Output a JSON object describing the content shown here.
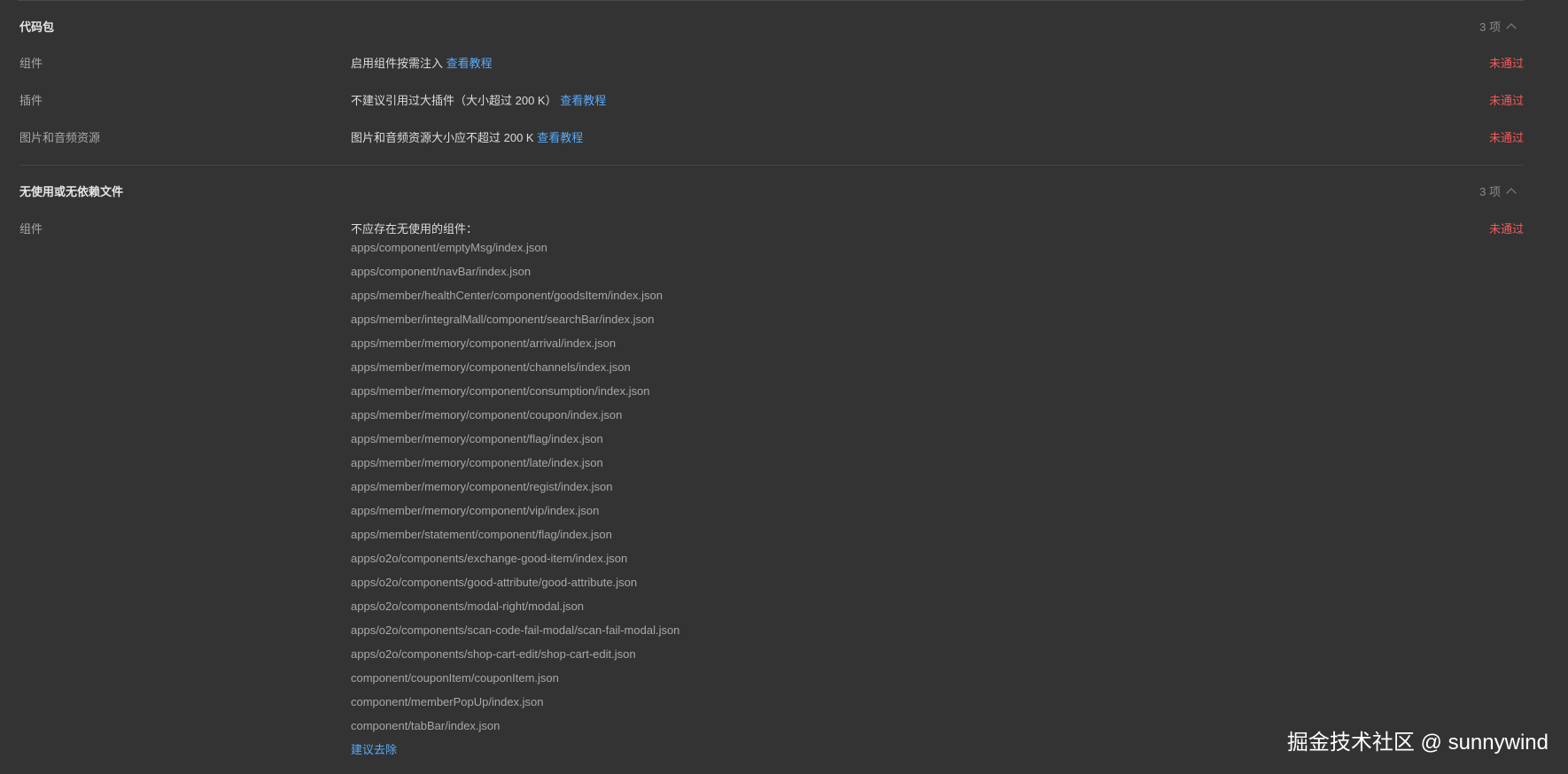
{
  "sections": [
    {
      "title": "代码包",
      "count": "3 项",
      "rows": [
        {
          "label": "组件",
          "desc": "启用组件按需注入",
          "link": "查看教程",
          "status": "未通过"
        },
        {
          "label": "插件",
          "desc": "不建议引用过大插件（大小超过 200 K）",
          "link": "查看教程",
          "status": "未通过"
        },
        {
          "label": "图片和音频资源",
          "desc": "图片和音频资源大小应不超过 200 K",
          "link": "查看教程",
          "status": "未通过"
        }
      ]
    },
    {
      "title": "无使用或无依赖文件",
      "count": "3 项",
      "rows": [
        {
          "label": "组件",
          "desc": "不应存在无使用的组件：",
          "status": "未通过"
        }
      ],
      "files": [
        "apps/component/emptyMsg/index.json",
        "apps/component/navBar/index.json",
        "apps/member/healthCenter/component/goodsItem/index.json",
        "apps/member/integralMall/component/searchBar/index.json",
        "apps/member/memory/component/arrival/index.json",
        "apps/member/memory/component/channels/index.json",
        "apps/member/memory/component/consumption/index.json",
        "apps/member/memory/component/coupon/index.json",
        "apps/member/memory/component/flag/index.json",
        "apps/member/memory/component/late/index.json",
        "apps/member/memory/component/regist/index.json",
        "apps/member/memory/component/vip/index.json",
        "apps/member/statement/component/flag/index.json",
        "apps/o2o/components/exchange-good-item/index.json",
        "apps/o2o/components/good-attribute/good-attribute.json",
        "apps/o2o/components/modal-right/modal.json",
        "apps/o2o/components/scan-code-fail-modal/scan-fail-modal.json",
        "apps/o2o/components/shop-cart-edit/shop-cart-edit.json",
        "component/couponItem/couponItem.json",
        "component/memberPopUp/index.json",
        "component/tabBar/index.json"
      ],
      "suggest": "建议去除"
    }
  ],
  "watermark": "掘金技术社区 @ sunnywind",
  "colors": {
    "background": "#333333",
    "link": "#5aa9f7",
    "fail": "#f25a5a"
  },
  "icons": {
    "collapse": "chevron-up-icon"
  }
}
